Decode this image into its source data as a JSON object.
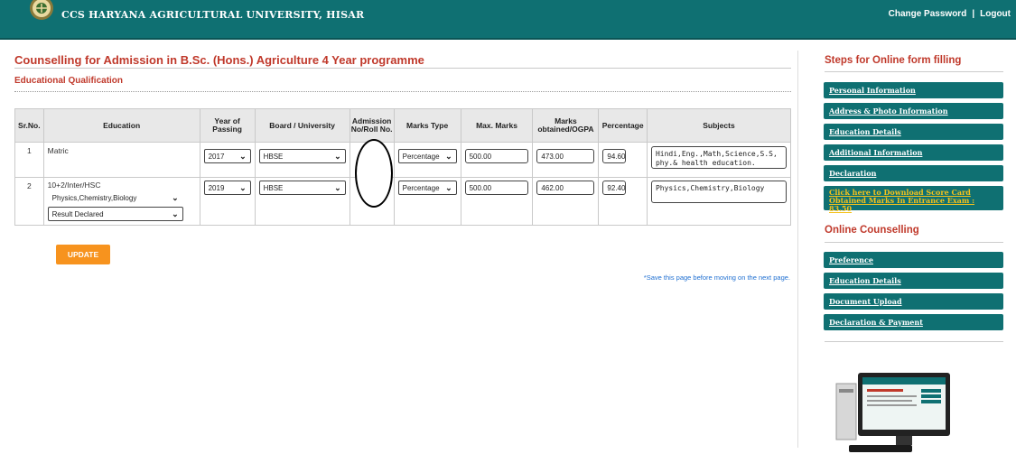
{
  "header": {
    "university": "CCS HARYANA AGRICULTURAL UNIVERSITY, HISAR",
    "change_password": "Change Password",
    "separator": "|",
    "logout": "Logout"
  },
  "main": {
    "title": "Counselling for Admission in B.Sc. (Hons.) Agriculture 4 Year programme",
    "section": "Educational Qualification",
    "columns": [
      "Sr.No.",
      "Education",
      "Year of Passing",
      "Board / University",
      "Admission No/Roll No.",
      "Marks Type",
      "Max. Marks",
      "Marks obtained/OGPA",
      "Percentage",
      "Subjects"
    ],
    "rows": [
      {
        "sr": "1",
        "education": "Matric",
        "year": "2017",
        "board": "HBSE",
        "marks_type": "Percentage",
        "max_marks": "500.00",
        "obtained": "473.00",
        "percentage": "94.60",
        "subjects": "Hindi,Eng.,Math,Science,S.S, phy.& health education."
      },
      {
        "sr": "2",
        "education": "10+2/Inter/HSC",
        "stream": "Physics,Chemistry,Biology",
        "result": "Result Declared",
        "year": "2019",
        "board": "HBSE",
        "marks_type": "Percentage",
        "max_marks": "500.00",
        "obtained": "462.00",
        "percentage": "92.40",
        "subjects": "Physics,Chemistry,Biology"
      }
    ],
    "update_label": "UPDATE",
    "save_note": "*Save this page before moving on the next page."
  },
  "sidebar": {
    "steps_heading": "Steps for Online form filling",
    "steps": [
      "Personal Information",
      "Address & Photo Information",
      "Education Details",
      "Additional Information",
      "Declaration"
    ],
    "score_link_line1": "Click here to Download Score Card",
    "score_link_line2": "Obtained Marks In Entrance Exam : 83.50",
    "counselling_heading": "Online Counselling",
    "counselling": [
      "Preference",
      "Education Details",
      "Document Upload",
      "Declaration & Payment"
    ]
  },
  "colors": {
    "header": "#0f7072",
    "accent_red": "#c0392b",
    "button_orange": "#f7931e",
    "link_yellow": "#f5c21b"
  }
}
